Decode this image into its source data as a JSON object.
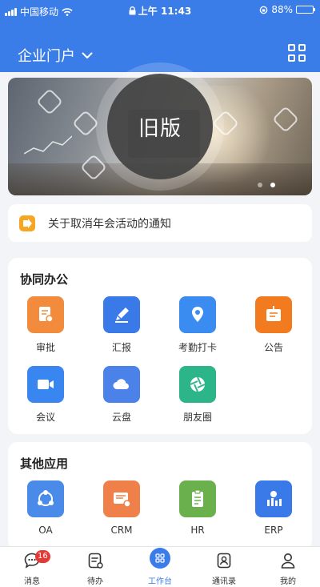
{
  "status_bar": {
    "carrier": "中国移动",
    "time": "上午 11:43",
    "battery": "88%",
    "battery_level": 0.88
  },
  "header": {
    "title": "企业门户"
  },
  "banner": {
    "overlay_label": "旧版"
  },
  "notice": {
    "text": "关于取消年会活动的通知"
  },
  "section_collab": {
    "title": "协同办公",
    "apps": [
      {
        "label": "审批",
        "icon": "approval-doc-icon",
        "color": "#f28b3c"
      },
      {
        "label": "汇报",
        "icon": "pen-report-icon",
        "color": "#3a7ae8"
      },
      {
        "label": "考勤打卡",
        "icon": "location-pin-icon",
        "color": "#3a8cf0"
      },
      {
        "label": "公告",
        "icon": "announcement-board-icon",
        "color": "#f27a1f"
      },
      {
        "label": "会议",
        "icon": "video-camera-icon",
        "color": "#3a86f0"
      },
      {
        "label": "云盘",
        "icon": "cloud-icon",
        "color": "#4a82ea"
      },
      {
        "label": "朋友圈",
        "icon": "aperture-icon",
        "color": "#2db58a"
      }
    ]
  },
  "section_other": {
    "title": "其他应用",
    "apps": [
      {
        "label": "OA",
        "icon": "oa-network-icon",
        "color": "#4a8ae8"
      },
      {
        "label": "CRM",
        "icon": "crm-card-icon",
        "color": "#f0804a"
      },
      {
        "label": "HR",
        "icon": "clipboard-icon",
        "color": "#6ab04c"
      },
      {
        "label": "ERP",
        "icon": "erp-chart-icon",
        "color": "#3a7ae8"
      }
    ]
  },
  "tabbar": {
    "tabs": [
      {
        "label": "消息",
        "icon": "message-icon",
        "badge": "16"
      },
      {
        "label": "待办",
        "icon": "todo-icon"
      },
      {
        "label": "工作台",
        "icon": "workbench-icon",
        "active": true
      },
      {
        "label": "通讯录",
        "icon": "contacts-icon"
      },
      {
        "label": "我的",
        "icon": "profile-icon"
      }
    ]
  },
  "colors": {
    "primary": "#3b7de8",
    "badge": "#e53935",
    "notice_icon": "#f5a623"
  }
}
